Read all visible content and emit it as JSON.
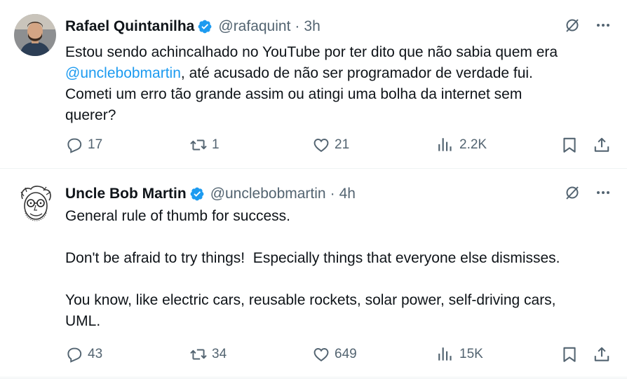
{
  "tweets": [
    {
      "name": "Rafael Quintanilha",
      "handle": "@rafaquint",
      "dot": "·",
      "time": "3h",
      "text_before": "Estou sendo achincalhado no YouTube por ter dito que não sabia quem era\n",
      "mention": "@unclebobmartin",
      "text_after": ", até acusado de não ser programador de verdade fui.\nCometi um erro tão grande assim ou atingi uma bolha da internet sem\nquerer?",
      "replies": "17",
      "retweets": "1",
      "likes": "21",
      "views": "2.2K"
    },
    {
      "name": "Uncle Bob Martin",
      "handle": "@unclebobmartin",
      "dot": "·",
      "time": "4h",
      "text": "General rule of thumb for success.\n\nDon't be afraid to try things!  Especially things that everyone else dismisses.\n\nYou know, like electric cars, reusable rockets, solar power, self-driving cars,\nUML.",
      "replies": "43",
      "retweets": "34",
      "likes": "649",
      "views": "15K"
    }
  ],
  "icons": {
    "verified": "verified-badge-icon",
    "grok": "grok-icon",
    "more": "more-icon",
    "reply": "reply-icon",
    "retweet": "retweet-icon",
    "like": "like-icon",
    "views": "views-icon",
    "bookmark": "bookmark-icon",
    "share": "share-icon"
  },
  "colors": {
    "accent": "#1d9bf0",
    "secondary_text": "#536471",
    "primary_text": "#0f1419",
    "divider": "#eff3f4"
  }
}
